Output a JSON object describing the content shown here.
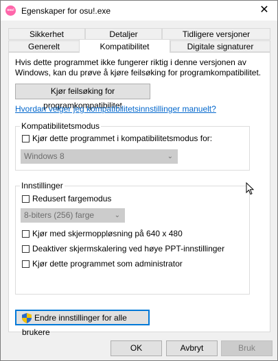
{
  "window": {
    "title": "Egenskaper for osu!.exe",
    "app_icon_label": "osu!",
    "close_glyph": "✕"
  },
  "tabs": {
    "row1": [
      "Sikkerhet",
      "Detaljer",
      "Tidligere versjoner"
    ],
    "row2": [
      "Generelt",
      "Kompatibilitet",
      "Digitale signaturer"
    ],
    "active": "Kompatibilitet"
  },
  "compat": {
    "info": "Hvis dette programmet ikke fungerer riktig i denne versjonen av Windows, kan du prøve å kjøre feilsøking for programkompatibilitet.",
    "troubleshoot_button": "Kjør feilsøking for programkompatibilitet",
    "help_link": "Hvordan velger jeg kompatibilitetsinnstillinger manuelt?",
    "mode_group": {
      "label": "Kompatibilitetsmodus",
      "checkbox": "Kjør dette programmet i kompatibilitetsmodus for:",
      "select_value": "Windows 8"
    },
    "settings_group": {
      "label": "Innstillinger",
      "reduced_color": "Redusert fargemodus",
      "color_select_value": "8-biters (256) farge",
      "resolution": "Kjør med skjermoppløsning på 640 x 480",
      "dpi_scaling": "Deaktiver skjermskalering ved høye PPT-innstillinger",
      "admin": "Kjør dette programmet som administrator"
    },
    "all_users_button": "Endre innstillinger for alle brukere"
  },
  "footer": {
    "ok": "OK",
    "cancel": "Avbryt",
    "apply": "Bruk"
  }
}
